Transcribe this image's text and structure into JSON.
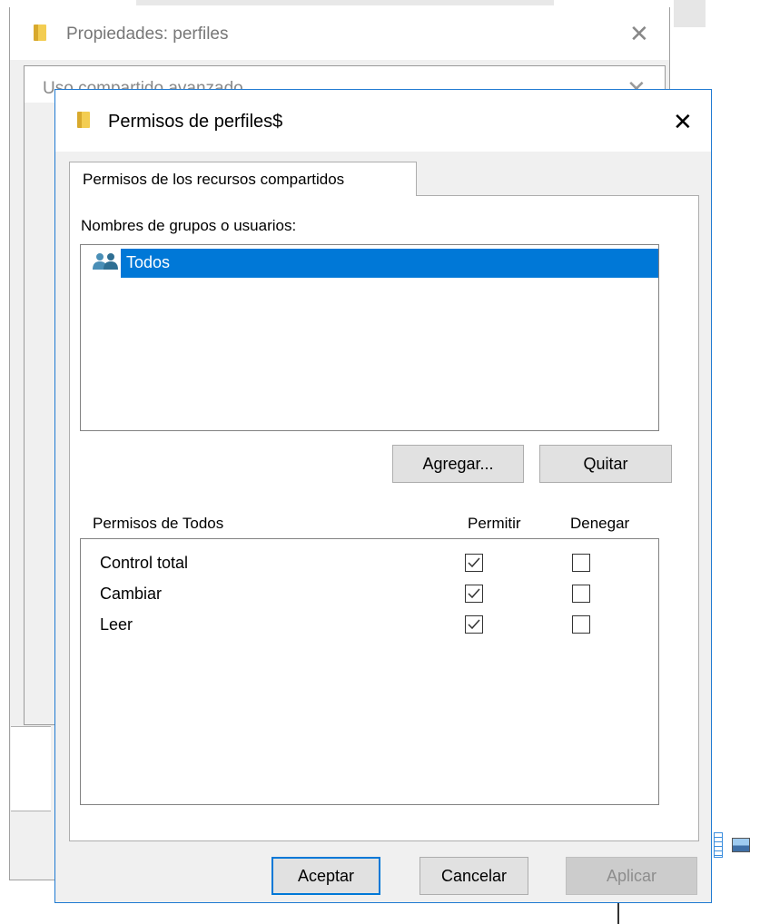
{
  "background": {
    "properties_window": {
      "title": "Propiedades: perfiles",
      "close_glyph": "✕"
    },
    "advanced_sharing_window": {
      "title": "Uso compartido avanzado",
      "close_glyph": "✕"
    }
  },
  "dialog": {
    "title": "Permisos de perfiles$",
    "close_glyph": "✕",
    "tab_label": "Permisos de los recursos compartidos",
    "groups_label": "Nombres de grupos o usuarios:",
    "users": [
      {
        "name": "Todos",
        "icon": "users-group-icon",
        "selected": true
      }
    ],
    "add_button": "Agregar...",
    "remove_button": "Quitar",
    "permissions_label": "Permisos de Todos",
    "allow_header": "Permitir",
    "deny_header": "Denegar",
    "permissions": [
      {
        "name": "Control total",
        "allow": true,
        "deny": false
      },
      {
        "name": "Cambiar",
        "allow": true,
        "deny": false
      },
      {
        "name": "Leer",
        "allow": true,
        "deny": false
      }
    ],
    "ok_button": "Aceptar",
    "cancel_button": "Cancelar",
    "apply_button": "Aplicar"
  },
  "colors": {
    "accent": "#0078d7",
    "selection": "#0078d7",
    "dialog_border": "#1f7ad2",
    "folder": "#f3cd52"
  }
}
